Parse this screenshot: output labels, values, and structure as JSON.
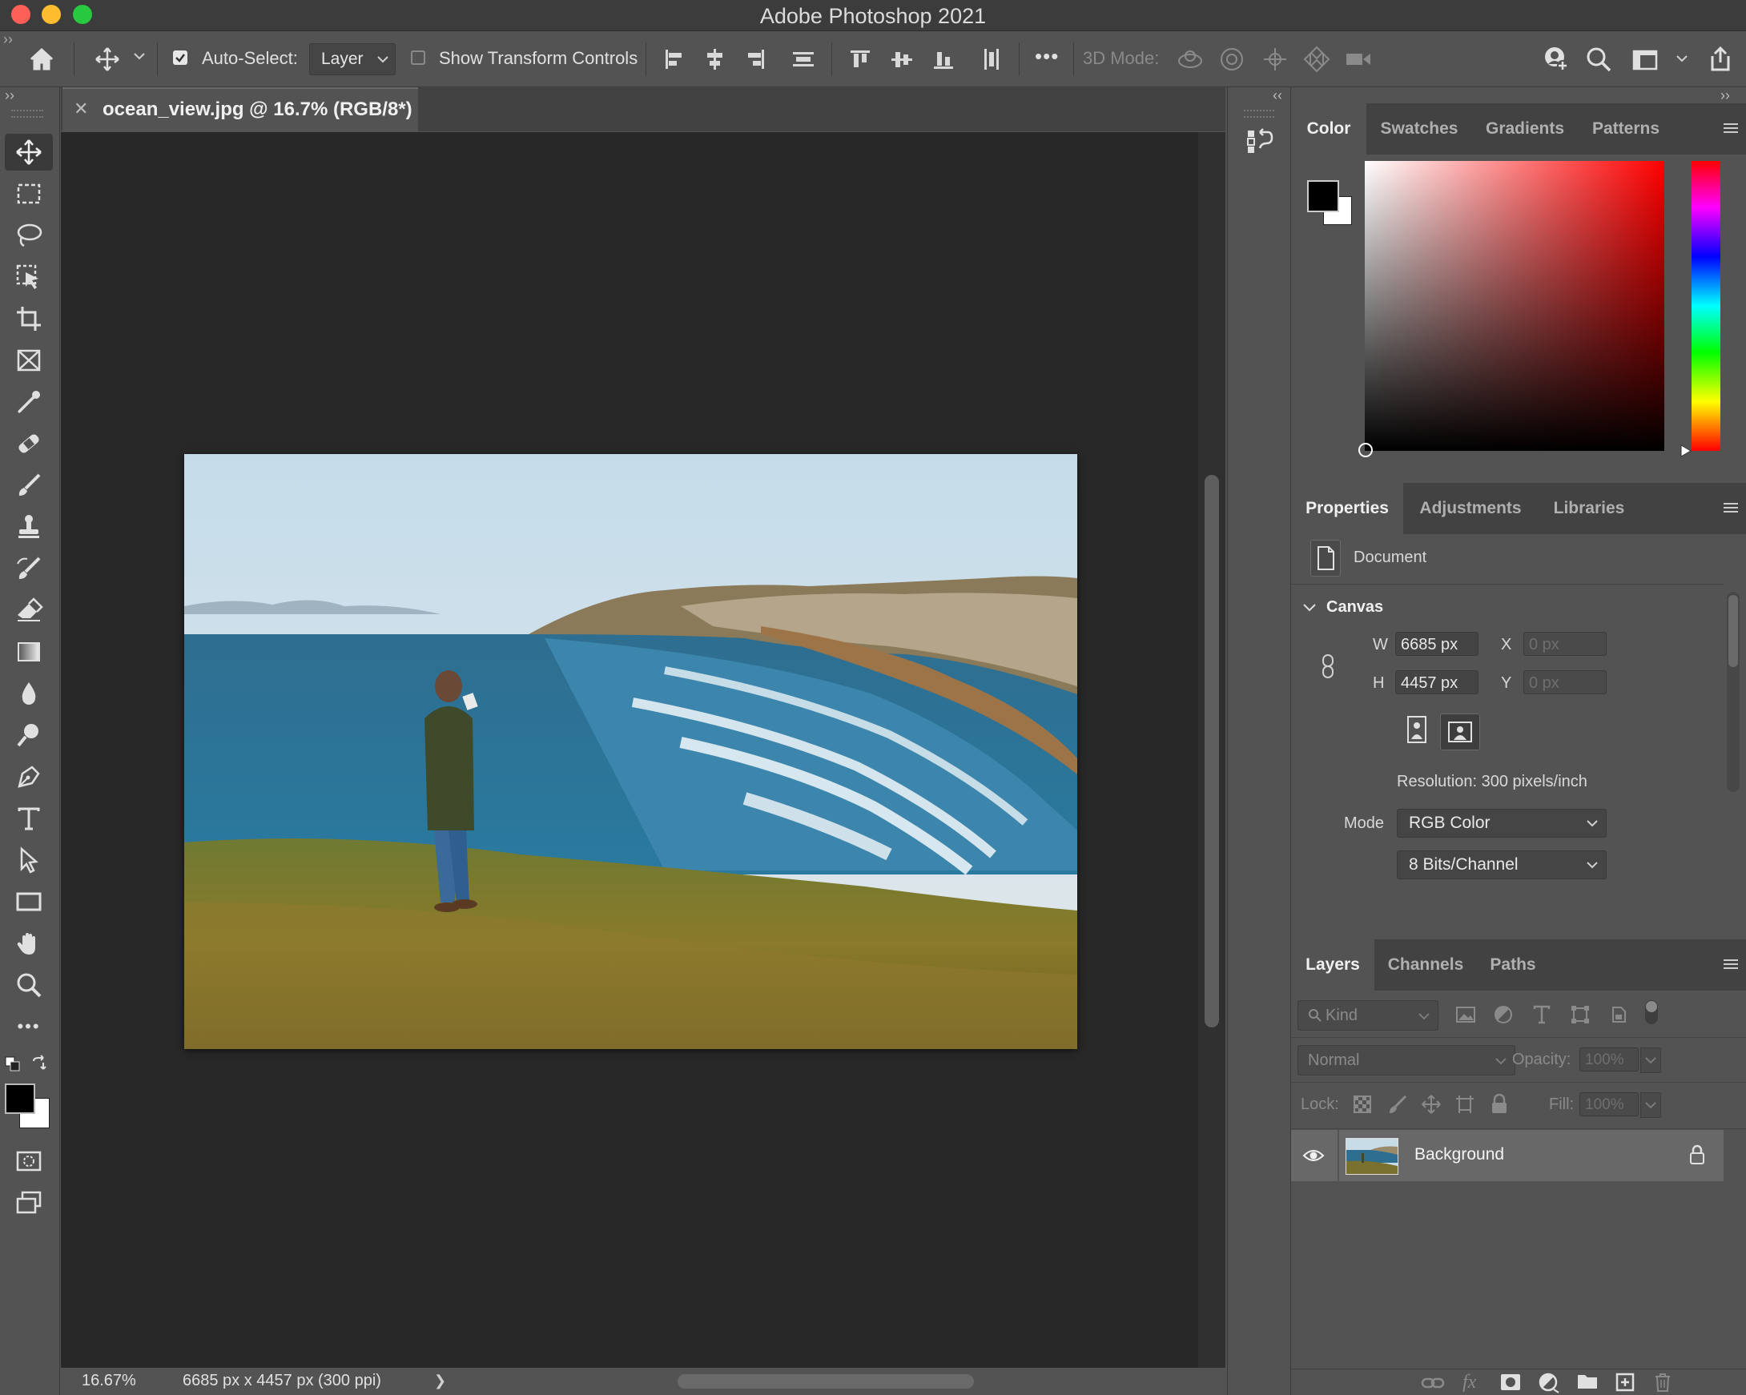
{
  "window": {
    "title": "Adobe Photoshop 2021"
  },
  "options_bar": {
    "auto_select_label": "Auto-Select:",
    "auto_select_checked": true,
    "auto_select_target": "Layer",
    "show_transform_label": "Show Transform Controls",
    "show_transform_checked": false,
    "more_label": "•••",
    "mode_3d_label": "3D Mode:"
  },
  "document": {
    "tab_title": "ocean_view.jpg @ 16.7% (RGB/8*)",
    "zoom": "16.67%",
    "dimensions_status": "6685 px x 4457 px (300 ppi)",
    "status_arrow": "❯"
  },
  "color_panel": {
    "tabs": [
      "Color",
      "Swatches",
      "Gradients",
      "Patterns"
    ],
    "active_tab": "Color",
    "foreground": "#000000",
    "background": "#ffffff",
    "hue_color": "#ff0000"
  },
  "properties_panel": {
    "tabs": [
      "Properties",
      "Adjustments",
      "Libraries"
    ],
    "active_tab": "Properties",
    "doc_label": "Document",
    "section": "Canvas",
    "w_label": "W",
    "w_value": "6685 px",
    "h_label": "H",
    "h_value": "4457 px",
    "x_label": "X",
    "x_value": "0 px",
    "y_label": "Y",
    "y_value": "0 px",
    "resolution": "Resolution: 300 pixels/inch",
    "mode_label": "Mode",
    "mode_value": "RGB Color",
    "bit_depth": "8 Bits/Channel"
  },
  "layers_panel": {
    "tabs": [
      "Layers",
      "Channels",
      "Paths"
    ],
    "active_tab": "Layers",
    "filter_kind": "Kind",
    "blend_mode": "Normal",
    "opacity_label": "Opacity:",
    "opacity_value": "100%",
    "lock_label": "Lock:",
    "fill_label": "Fill:",
    "fill_value": "100%",
    "layers": [
      {
        "name": "Background",
        "visible": true,
        "locked": true
      }
    ]
  },
  "colors": {
    "accent_red": "#fe5f57",
    "accent_yellow": "#febc2e",
    "accent_green": "#28c840"
  }
}
